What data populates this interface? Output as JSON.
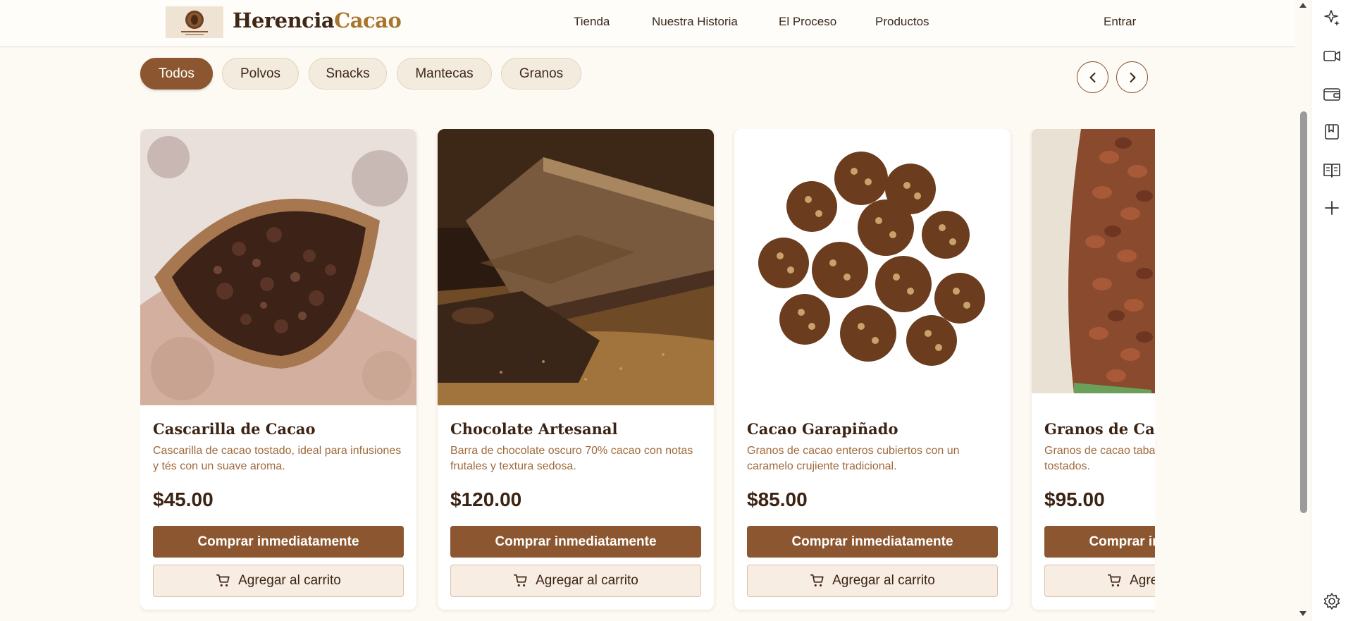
{
  "header": {
    "brand_part1": "Herencia",
    "brand_part2": "Cacao",
    "nav": [
      "Tienda",
      "Nuestra Historia",
      "El Proceso",
      "Productos"
    ],
    "login": "Entrar"
  },
  "filters": {
    "chips": [
      "Todos",
      "Polvos",
      "Snacks",
      "Mantecas",
      "Granos"
    ],
    "active": "Todos"
  },
  "products": [
    {
      "title": "Cascarilla de Cacao",
      "description": "Cascarilla de cacao tostado, ideal para infusiones y tés con un suave aroma.",
      "price": "$45.00",
      "buy_label": "Comprar inmediatamente",
      "cart_label": "Agregar al carrito"
    },
    {
      "title": "Chocolate Artesanal",
      "description": "Barra de chocolate oscuro 70% cacao con notas frutales y textura sedosa.",
      "price": "$120.00",
      "buy_label": "Comprar inmediatamente",
      "cart_label": "Agregar al carrito"
    },
    {
      "title": "Cacao Garapiñado",
      "description": "Granos de cacao enteros cubiertos con un caramelo crujiente tradicional.",
      "price": "$85.00",
      "buy_label": "Comprar inmediatamente",
      "cart_label": "Agregar al carrito"
    },
    {
      "title": "Granos de Cacao",
      "description": "Granos de cacao tabasqueño fermentados y tostados.",
      "price": "$95.00",
      "buy_label": "Comprar inmediatamente",
      "cart_label": "Agregar al carrito"
    }
  ],
  "icons": {
    "prev": "chevron-left-icon",
    "next": "chevron-right-icon",
    "cart": "cart-icon",
    "sidebar": [
      "sparkle-star-icon",
      "video-icon",
      "wallet-icon",
      "bookmark-icon",
      "reading-list-icon",
      "plus-icon",
      "settings-icon"
    ]
  },
  "colors": {
    "primary": "#8c5730",
    "accent": "#a8752c",
    "background": "#fdf9f3"
  }
}
